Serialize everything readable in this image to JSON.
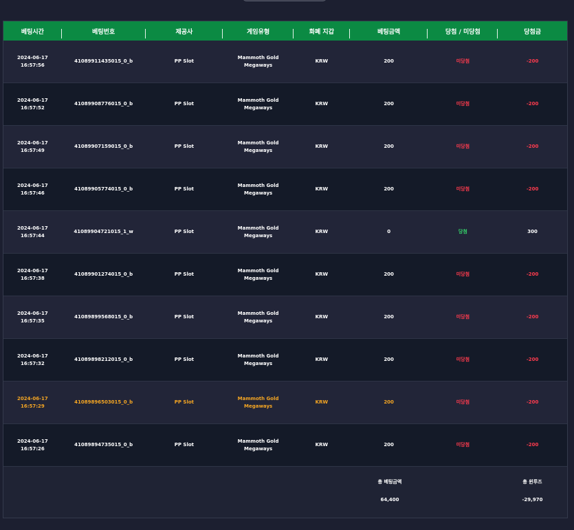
{
  "headers": [
    "베팅시간",
    "베팅번호",
    "제공사",
    "게임유형",
    "화폐 지갑",
    "베팅금액",
    "당첨 / 미당첨",
    "당첨금"
  ],
  "rows": [
    {
      "date": "2024-06-17",
      "time": "16:57:56",
      "bet_id": "41089911435015_0_b",
      "provider": "PP Slot",
      "game": "Mammoth Gold Megaways",
      "currency": "KRW",
      "bet": "200",
      "result": "미당첨",
      "status": "loss",
      "payout": "-200",
      "highlight": false
    },
    {
      "date": "2024-06-17",
      "time": "16:57:52",
      "bet_id": "41089908776015_0_b",
      "provider": "PP Slot",
      "game": "Mammoth Gold Megaways",
      "currency": "KRW",
      "bet": "200",
      "result": "미당첨",
      "status": "loss",
      "payout": "-200",
      "highlight": false
    },
    {
      "date": "2024-06-17",
      "time": "16:57:49",
      "bet_id": "41089907159015_0_b",
      "provider": "PP Slot",
      "game": "Mammoth Gold Megaways",
      "currency": "KRW",
      "bet": "200",
      "result": "미당첨",
      "status": "loss",
      "payout": "-200",
      "highlight": false
    },
    {
      "date": "2024-06-17",
      "time": "16:57:46",
      "bet_id": "41089905774015_0_b",
      "provider": "PP Slot",
      "game": "Mammoth Gold Megaways",
      "currency": "KRW",
      "bet": "200",
      "result": "미당첨",
      "status": "loss",
      "payout": "-200",
      "highlight": false
    },
    {
      "date": "2024-06-17",
      "time": "16:57:44",
      "bet_id": "41089904721015_1_w",
      "provider": "PP Slot",
      "game": "Mammoth Gold Megaways",
      "currency": "KRW",
      "bet": "0",
      "result": "당첨",
      "status": "win",
      "payout": "300",
      "highlight": false
    },
    {
      "date": "2024-06-17",
      "time": "16:57:38",
      "bet_id": "41089901274015_0_b",
      "provider": "PP Slot",
      "game": "Mammoth Gold Megaways",
      "currency": "KRW",
      "bet": "200",
      "result": "미당첨",
      "status": "loss",
      "payout": "-200",
      "highlight": false
    },
    {
      "date": "2024-06-17",
      "time": "16:57:35",
      "bet_id": "41089899568015_0_b",
      "provider": "PP Slot",
      "game": "Mammoth Gold Megaways",
      "currency": "KRW",
      "bet": "200",
      "result": "미당첨",
      "status": "loss",
      "payout": "-200",
      "highlight": false
    },
    {
      "date": "2024-06-17",
      "time": "16:57:32",
      "bet_id": "41089898212015_0_b",
      "provider": "PP Slot",
      "game": "Mammoth Gold Megaways",
      "currency": "KRW",
      "bet": "200",
      "result": "미당첨",
      "status": "loss",
      "payout": "-200",
      "highlight": false
    },
    {
      "date": "2024-06-17",
      "time": "16:57:29",
      "bet_id": "41089896503015_0_b",
      "provider": "PP Slot",
      "game": "Mammoth Gold Megaways",
      "currency": "KRW",
      "bet": "200",
      "result": "미당첨",
      "status": "loss",
      "payout": "-200",
      "highlight": true
    },
    {
      "date": "2024-06-17",
      "time": "16:57:26",
      "bet_id": "41089894735015_0_b",
      "provider": "PP Slot",
      "game": "Mammoth Gold Megaways",
      "currency": "KRW",
      "bet": "200",
      "result": "미당첨",
      "status": "loss",
      "payout": "-200",
      "highlight": false
    }
  ],
  "totals": {
    "bet_label": "총 베팅금액",
    "bet_value": "64,400",
    "win_label": "총 윈루즈",
    "win_value": "-29,970"
  },
  "colors": {
    "header_bg": "#0b8a43",
    "loss": "#ff3b4e",
    "win": "#35d46a",
    "highlight": "#f5a623"
  }
}
